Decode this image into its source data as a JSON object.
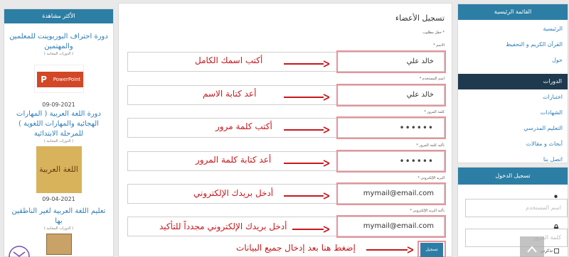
{
  "right_menu": {
    "header": "القائمة الرئيسية",
    "items": [
      "الرئيسية",
      "القرآن الكريم و التحفيظ",
      "حول"
    ],
    "courses_header": "الدورات",
    "course_items": [
      "اختبارات",
      "الشهادات",
      "التعليم المدرسي",
      "أبحاث و مقالات",
      "اتصل بنا"
    ]
  },
  "login": {
    "header": "تسجيل الدخول",
    "username_placeholder": "اسم المستخدم",
    "password_placeholder": "كلمة المرور",
    "remember_label": "تذكرني"
  },
  "most_viewed": {
    "header": "الأكثر مشاهدة",
    "items": [
      {
        "title": "دورة احتراف البوربوينت للمعلمين والمهتمين",
        "category": "( الدورات المجانية )",
        "thumb_text": "PowerPoint",
        "date": "09-09-2021"
      },
      {
        "title": "دورة اللغة العربية ( المهارات الهجائية والمهارات اللغوية ) للمرحلة الابتدائية",
        "category": "( الدورات المجانية )",
        "thumb_text": "اللغة العربية",
        "date": "09-04-2021"
      },
      {
        "title": "تعليم اللغة العربية لغير الناطقين بها",
        "category": "( الدورات المجانية )",
        "thumb_text": "",
        "date": ""
      }
    ]
  },
  "form": {
    "title": "تسجيل الأعضاء",
    "required_note": "* حقل مطلوب",
    "labels": {
      "name": "الاسم *",
      "username": "اسم المستخدم *",
      "password": "كلمة المرور *",
      "password_confirm": "تأكيد كلمة المرور *",
      "email": "البريد الإلكتروني *",
      "email_confirm": "تأكيد البريد الإلكتروني *"
    },
    "values": {
      "name": "خالد علي",
      "username": "خالد علي",
      "password": "••••••",
      "password_confirm": "••••••",
      "email": "mymail@email.com",
      "email_confirm": "mymail@email.com"
    },
    "submit_label": "تسجيل"
  },
  "annotations": {
    "name": "أكتب اسمك الكامل",
    "username": "أعد كتابة الاسم",
    "password": "أكتب كلمة مرور",
    "password_confirm": "أعد كتابة كلمة المرور",
    "email": "أدخل بريدك الإلكتروني",
    "email_confirm": "أدخل بريدك الإلكتروني مجدداً للتأكيد",
    "submit": "إضغط هنا بعد إدخال جميع البيانات"
  },
  "colors": {
    "accent": "#2d7ea5",
    "dark_header": "#1f3a4e",
    "annotation_red": "#c8171c",
    "highlight_pink": "#e8939b",
    "link_blue": "#2e7eb6"
  }
}
